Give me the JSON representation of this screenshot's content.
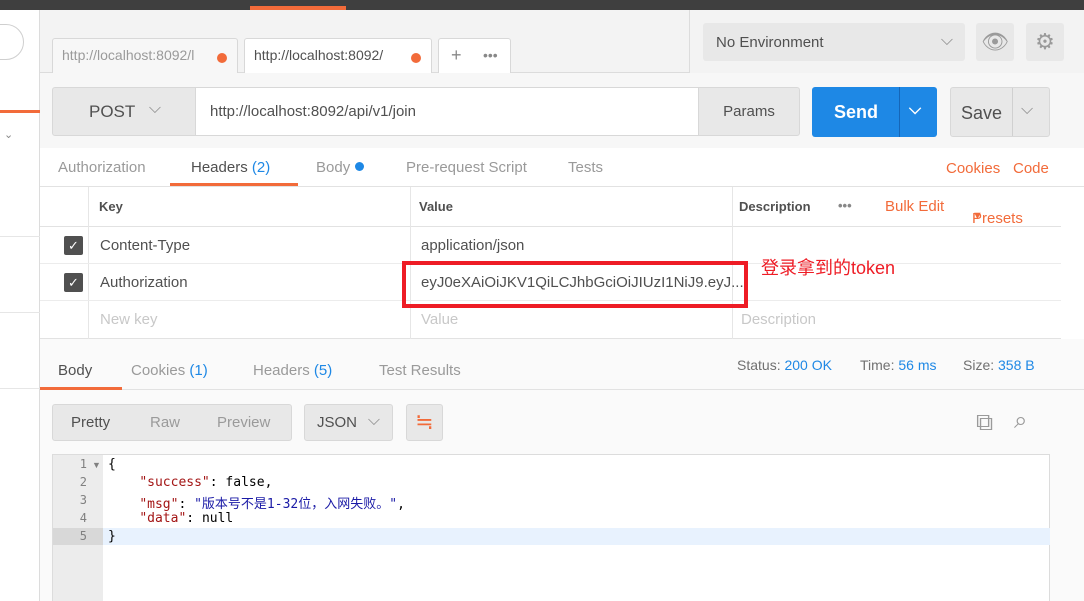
{
  "tabs": [
    {
      "label": "http://localhost:8092/l"
    },
    {
      "label": "http://localhost:8092/"
    }
  ],
  "tab_tools": {
    "add": "+",
    "more": "•••"
  },
  "environment": {
    "selected": "No Environment"
  },
  "request": {
    "method": "POST",
    "url": "http://localhost:8092/api/v1/join",
    "params_label": "Params",
    "send_label": "Send",
    "save_label": "Save"
  },
  "request_tabs": {
    "authorization": "Authorization",
    "headers": "Headers",
    "headers_count": "(2)",
    "body": "Body",
    "prerequest": "Pre-request Script",
    "tests": "Tests",
    "cookies": "Cookies",
    "code": "Code"
  },
  "headers_table": {
    "col_key": "Key",
    "col_value": "Value",
    "col_description": "Description",
    "more": "•••",
    "bulk_edit": "Bulk Edit",
    "presets": "Presets",
    "rows": [
      {
        "key": "Content-Type",
        "value": "application/json"
      },
      {
        "key": "Authorization",
        "value": "eyJ0eXAiOiJKV1QiLCJhbGciOiJIUzI1NiJ9.eyJ..."
      }
    ],
    "new_key_placeholder": "New key",
    "new_value_placeholder": "Value",
    "new_desc_placeholder": "Description"
  },
  "annotation": "登录拿到的token",
  "response": {
    "tabs": {
      "body": "Body",
      "cookies": "Cookies",
      "cookies_count": "(1)",
      "headers": "Headers",
      "headers_count": "(5)",
      "test_results": "Test Results"
    },
    "status_label": "Status:",
    "status_value": "200 OK",
    "time_label": "Time:",
    "time_value": "56 ms",
    "size_label": "Size:",
    "size_value": "358 B",
    "format": {
      "pretty": "Pretty",
      "raw": "Raw",
      "preview": "Preview",
      "type": "JSON"
    },
    "lines": [
      "1",
      "2",
      "3",
      "4",
      "5"
    ],
    "code": {
      "open": "{",
      "success_key": "\"success\"",
      "success_val": "false",
      "msg_key": "\"msg\"",
      "msg_val": "\"版本号不是1-32位，入网失败。\"",
      "data_key": "\"data\"",
      "data_val": "null",
      "close": "}"
    }
  },
  "colors": {
    "accent": "#f26b3a",
    "primary": "#1e88e5",
    "annotation": "#ee1c25"
  }
}
